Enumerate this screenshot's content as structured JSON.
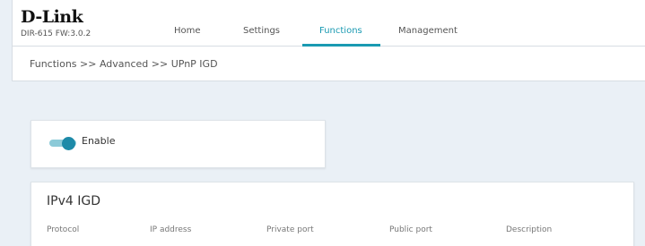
{
  "brand": {
    "logo": "D-Link",
    "firmware": "DIR-615 FW:3.0.2"
  },
  "nav": {
    "items": [
      {
        "label": "Home"
      },
      {
        "label": "Settings"
      },
      {
        "label": "Functions"
      },
      {
        "label": "Management"
      }
    ],
    "active": "Functions",
    "accent_color": "#1a9ab2"
  },
  "breadcrumb": "Functions >> Advanced >> UPnP IGD",
  "enable_card": {
    "label": "Enable",
    "toggle_on": true
  },
  "ipv4_card": {
    "title": "IPv4 IGD",
    "columns": [
      "Protocol",
      "IP address",
      "Private port",
      "Public port",
      "Description"
    ]
  }
}
